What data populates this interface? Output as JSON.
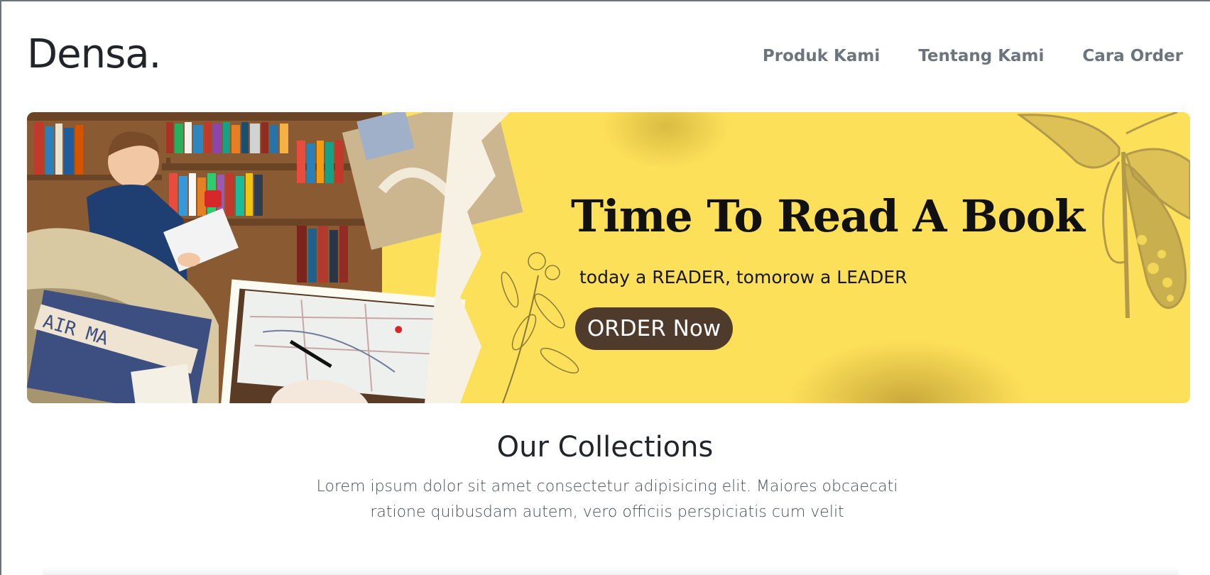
{
  "navbar": {
    "brand": "Densa.",
    "links": [
      {
        "label": "Produk Kami"
      },
      {
        "label": "Tentang Kami"
      },
      {
        "label": "Cara Order"
      }
    ]
  },
  "banner": {
    "headline": "Time To Read A Book",
    "tagline": "today a READER, tomorow a LEADER",
    "button_label": "ORDER Now",
    "photo_lettering": "AIR MA",
    "colors": {
      "background": "#fde059",
      "button": "#4e3b2b",
      "butterfly": "#b39a4a"
    }
  },
  "collections": {
    "title": "Our Collections",
    "description": "Lorem ipsum dolor sit amet consectetur adipisicing elit. Maiores obcaecati ratione quibusdam autem, vero officiis perspiciatis cum velit"
  }
}
